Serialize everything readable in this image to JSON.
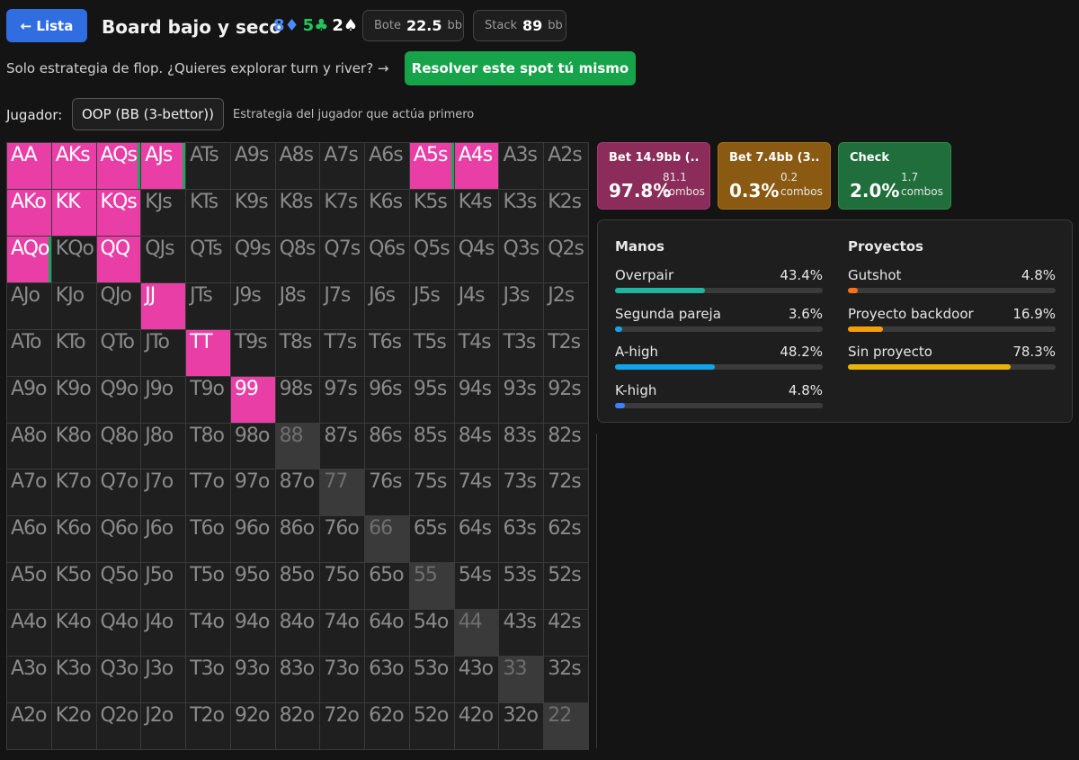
{
  "header": {
    "back_label": "← Lista",
    "title": "Board bajo y seco",
    "board": [
      {
        "rank": "8",
        "suit": "♦",
        "color": "#4b8df8"
      },
      {
        "rank": "5",
        "suit": "♣",
        "color": "#22c55e"
      },
      {
        "rank": "2",
        "suit": "♠",
        "color": "#ffffff"
      }
    ],
    "pot_label": "Bote",
    "pot_value": "22.5",
    "pot_unit": "bb",
    "stack_label": "Stack",
    "stack_value": "89",
    "stack_unit": "bb"
  },
  "flop_note": "Solo estrategia de flop. ¿Quieres explorar turn y river? →",
  "solve_button": "Resolver este spot tú mismo",
  "player": {
    "label": "Jugador:",
    "selected": "OOP (BB (3-bettor))",
    "description": "Estrategia del jugador que actúa primero"
  },
  "actions": [
    {
      "name": "Bet 14.9bb (...",
      "pct": "97.8%",
      "combos_value": "81.1",
      "combos_label": "combos",
      "color": "#8b2c5a",
      "border": "#a33a6d"
    },
    {
      "name": "Bet 7.4bb (3...",
      "pct": "0.3%",
      "combos_value": "0.2",
      "combos_label": "combos",
      "color": "#8a5a12",
      "border": "#a66d18"
    },
    {
      "name": "Check",
      "pct": "2.0%",
      "combos_value": "1.7",
      "combos_label": "combos",
      "color": "#1f6e3b",
      "border": "#2b8a4b"
    }
  ],
  "stats": {
    "hands_title": "Manos",
    "hands": [
      {
        "label": "Overpair",
        "value": "43.4%",
        "fraction": 0.434,
        "color": "#1fb5a0"
      },
      {
        "label": "Segunda pareja",
        "value": "3.6%",
        "fraction": 0.036,
        "color": "#0ea5e9"
      },
      {
        "label": "A-high",
        "value": "48.2%",
        "fraction": 0.482,
        "color": "#0ea5e9"
      },
      {
        "label": "K-high",
        "value": "4.8%",
        "fraction": 0.048,
        "color": "#3b82f6"
      }
    ],
    "draws_title": "Proyectos",
    "draws": [
      {
        "label": "Gutshot",
        "value": "4.8%",
        "fraction": 0.048,
        "color": "#f97316"
      },
      {
        "label": "Proyecto backdoor",
        "value": "16.9%",
        "fraction": 0.169,
        "color": "#f59e0b"
      },
      {
        "label": "Sin proyecto",
        "value": "78.3%",
        "fraction": 0.783,
        "color": "#eab308"
      }
    ]
  },
  "grid": {
    "ranks": [
      "A",
      "K",
      "Q",
      "J",
      "T",
      "9",
      "8",
      "7",
      "6",
      "5",
      "4",
      "3",
      "2"
    ],
    "highlighted": [
      "AA",
      "AKs",
      "AQs",
      "AJs",
      "A5s",
      "A4s",
      "AKo",
      "KK",
      "KQs",
      "AQo",
      "QQ",
      "JJ",
      "TT",
      "99"
    ],
    "edge_marked": [
      "AQs",
      "AJs",
      "A5s",
      "AQo"
    ],
    "highlight_color": "#e93ea6"
  }
}
